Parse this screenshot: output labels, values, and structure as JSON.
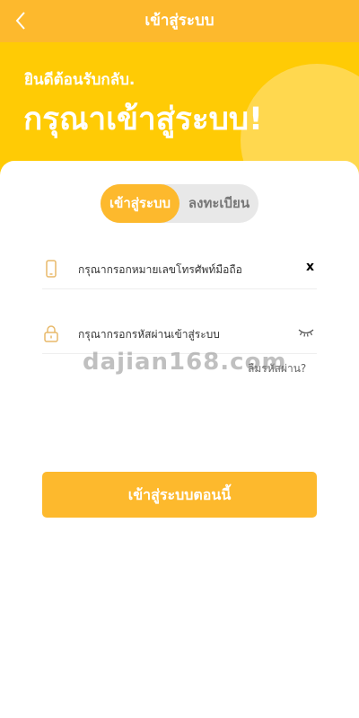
{
  "header": {
    "title": "เข้าสู่ระบบ",
    "back_icon": "chevron-left-icon"
  },
  "hero": {
    "welcome": "ยินดีต้อนรับกลับ.",
    "title": "กรุณาเข้าสู่ระบบ!"
  },
  "tabs": [
    {
      "label": "เข้าสู่ระบบ",
      "active": true
    },
    {
      "label": "ลงทะเบียน",
      "active": false
    }
  ],
  "form": {
    "phone_placeholder": "กรุณากรอกหมายเลขโทรศัพท์มือถือ",
    "phone_icon": "phone-icon",
    "clear_label": "x",
    "password_placeholder": "กรุณากรอกรหัสผ่านเข้าสู่ระบบ",
    "password_icon": "lock-icon",
    "eye_icon": "eye-closed-icon",
    "forgot_label": "ลืมรหัสผ่าน?",
    "submit_label": "เข้าสู่ระบบตอนนี้"
  },
  "watermark": "dajian168.com",
  "colors": {
    "accent": "#fdb92d",
    "hero_bg": "#ffcb05",
    "tab_inactive_bg": "#e8e8e8"
  }
}
